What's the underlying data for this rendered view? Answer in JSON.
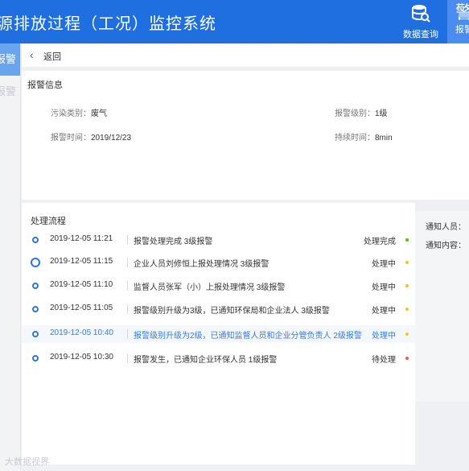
{
  "header": {
    "title": "源排放过程（工况）监控系统",
    "nav": [
      {
        "label": "数据查询",
        "icon": "database-search-icon"
      },
      {
        "label": "报警",
        "glyph": "警"
      }
    ]
  },
  "sidebar": {
    "items": [
      {
        "label": "报警"
      },
      {
        "label": "报警"
      }
    ]
  },
  "back": {
    "label": "返回"
  },
  "alarm_info": {
    "title": "报警信息",
    "pollution_type_label": "污染类别：",
    "pollution_type": "废气",
    "alarm_level_label": "报警级别：",
    "alarm_level": "1级",
    "alarm_time_label": "报警时间：",
    "alarm_time": "2019/12/23",
    "duration_label": "持续时间：",
    "duration": "8min"
  },
  "process": {
    "title": "处理流程",
    "rows": [
      {
        "time": "2019-12-05 11:21",
        "desc": "报警处理完成  3级报警",
        "status": "处理完成",
        "status_color": "#52c41a"
      },
      {
        "time": "2019-12-05 11:15",
        "desc": "企业人员刘修恒上报处理情况  3级报警",
        "status": "处理中",
        "status_color": "#f2c230"
      },
      {
        "time": "2019-12-05 11:10",
        "desc": "监督人员张军（小）上报处理情况  3级报警",
        "status": "处理中",
        "status_color": "#f2c230"
      },
      {
        "time": "2019-12-05 11:05",
        "desc": "报警级别升级为3级，已通知环保局和企业法人  3级报警",
        "status": "处理中",
        "status_color": "#f2c230"
      },
      {
        "time": "2019-12-05 10:40",
        "desc": "报警级别升级为2级，已通知监督人员和企业分管负责人  2级报警",
        "status": "处理中",
        "status_color": "#f2c230"
      },
      {
        "time": "2019-12-05 10:30",
        "desc": "报警发生，已通知企业环保人员  1级报警",
        "status": "待处理",
        "status_color": "#f05a4a"
      }
    ]
  },
  "notify": {
    "person_label": "通知人员：",
    "content_label": "通知内容："
  },
  "watermark": "大数据视界",
  "colors": {
    "primary": "#1f6fe0",
    "highlight_text": "#3a7be0"
  }
}
